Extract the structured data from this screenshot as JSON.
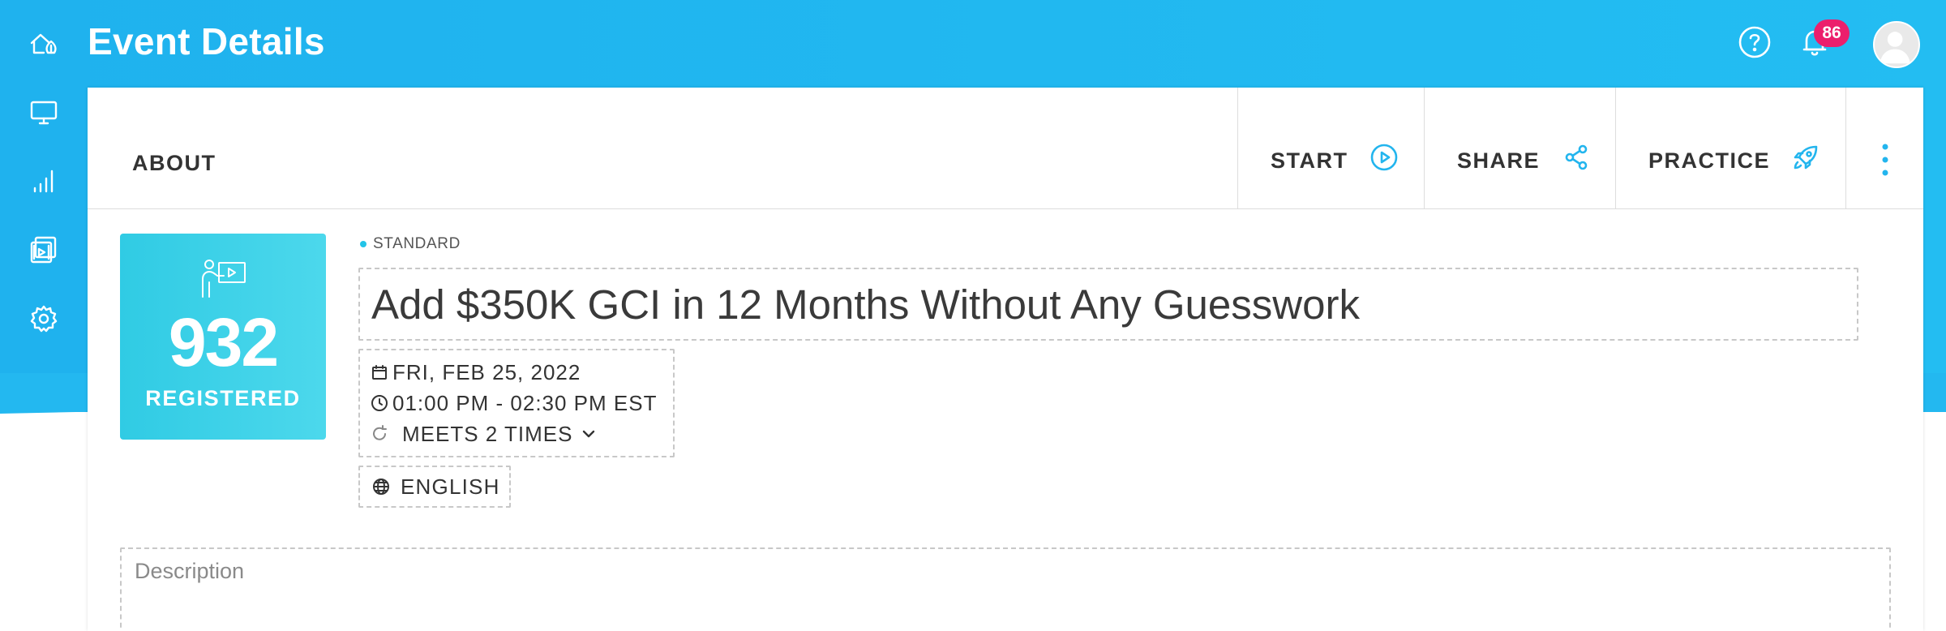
{
  "header": {
    "title": "Event Details",
    "notification_count": "86",
    "accent_color": "#23b5ee",
    "badge_color": "#ec1f6c"
  },
  "sidebar": {
    "items": [
      {
        "icon": "home-icon"
      },
      {
        "icon": "monitor-icon"
      },
      {
        "icon": "analytics-icon"
      },
      {
        "icon": "media-library-icon"
      },
      {
        "icon": "settings-gear-icon"
      }
    ]
  },
  "card": {
    "tab_label": "ABOUT",
    "actions": {
      "start": "START",
      "share": "SHARE",
      "practice": "PRACTICE"
    }
  },
  "event": {
    "registered_count": "932",
    "registered_label": "REGISTERED",
    "type": "STANDARD",
    "title": "Add $350K GCI in 12 Months Without Any Guesswork",
    "date": "FRI, FEB 25, 2022",
    "time": "01:00 PM - 02:30 PM EST",
    "recurrence": "MEETS 2 TIMES",
    "language": "ENGLISH",
    "description_placeholder": "Description"
  }
}
